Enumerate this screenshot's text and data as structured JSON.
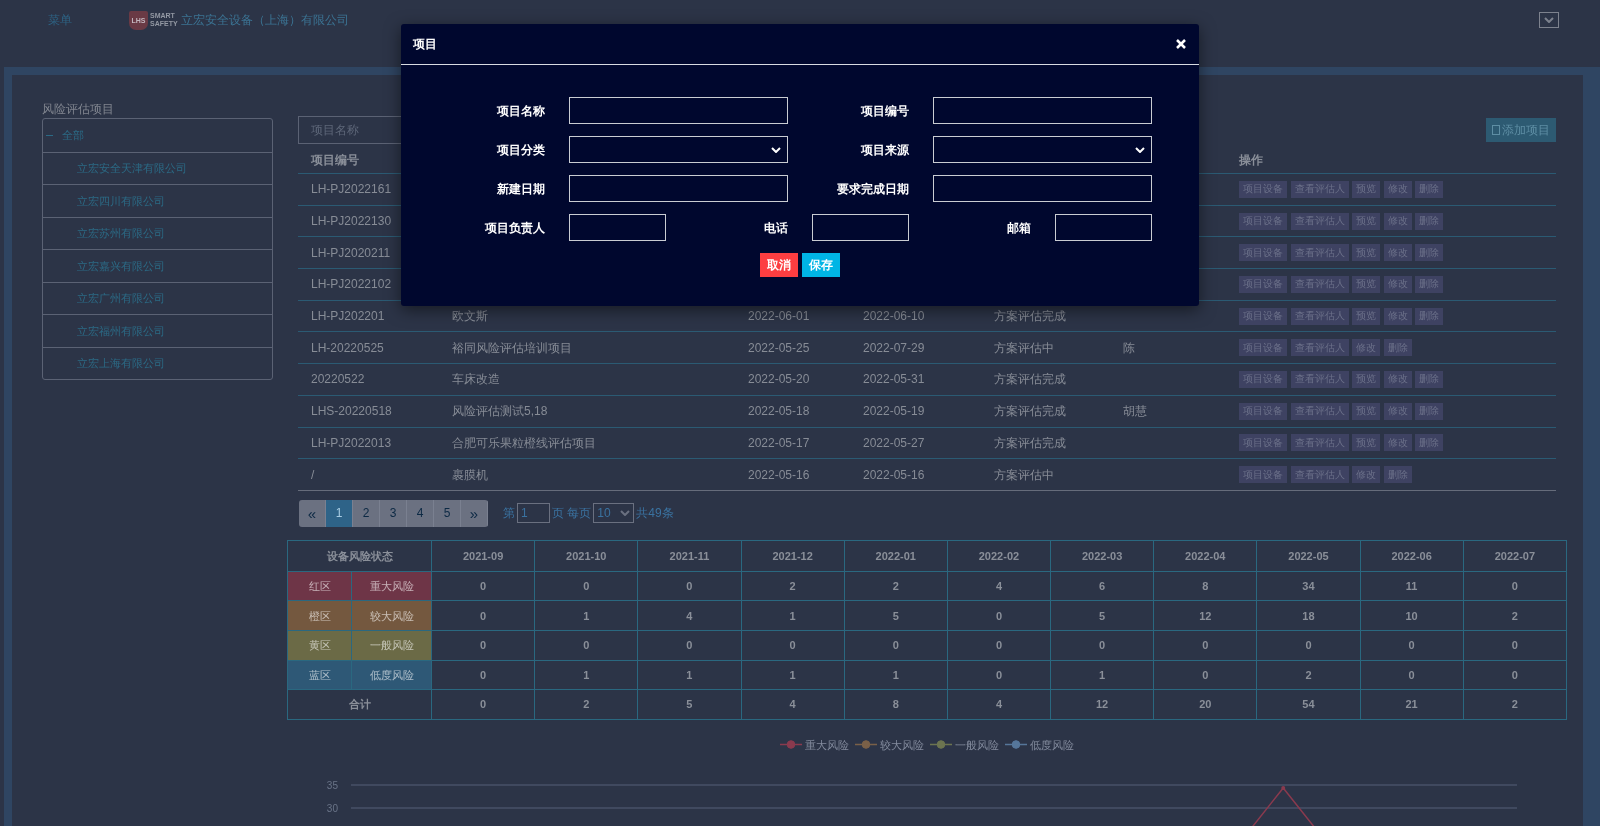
{
  "header": {
    "menu": "菜单",
    "logo": {
      "mark": "LHS",
      "wordmark": [
        "SMART",
        "SAFETY"
      ]
    },
    "company": "立宏安全设备（上海）有限公司"
  },
  "sidebar": {
    "title": "风险评估项目",
    "tree": [
      {
        "label": "全部",
        "expanded": true,
        "children": [
          {
            "label": "立宏安全天津有限公司"
          },
          {
            "label": "立宏四川有限公司"
          },
          {
            "label": "立宏苏州有限公司"
          },
          {
            "label": "立宏嘉兴有限公司"
          },
          {
            "label": "立宏广州有限公司"
          },
          {
            "label": "立宏福州有限公司"
          },
          {
            "label": "立宏上海有限公司"
          }
        ]
      }
    ]
  },
  "toolbar": {
    "search": {
      "placeholder": "项目名称"
    },
    "add_button": "添加项目"
  },
  "projects_table": {
    "headers": {
      "code": "项目编号",
      "actions": "操作"
    },
    "rows": [
      {
        "code": "LH-PJ2022161",
        "actions": [
          "项目设备",
          "查看评估人",
          "预览",
          "修改",
          "删除"
        ]
      },
      {
        "code": "LH-PJ2022130",
        "actions": [
          "项目设备",
          "查看评估人",
          "预览",
          "修改",
          "删除"
        ]
      },
      {
        "code": "LH-PJ2020211",
        "actions": [
          "项目设备",
          "查看评估人",
          "预览",
          "修改",
          "删除"
        ]
      },
      {
        "code": "LH-PJ2022102",
        "actions": [
          "项目设备",
          "查看评估人",
          "预览",
          "修改",
          "删除"
        ]
      },
      {
        "code": "LH-PJ202201",
        "column_2": "欧文斯",
        "column_3": "2022-06-01",
        "column_4": "2022-06-10",
        "column_5": "方案评估完成",
        "actions": [
          "项目设备",
          "查看评估人",
          "预览",
          "修改",
          "删除"
        ]
      },
      {
        "code": "LH-20220525",
        "column_2": "裕同风险评估培训项目",
        "column_3": "2022-05-25",
        "column_4": "2022-07-29",
        "column_5": "方案评估中",
        "column_6": "陈",
        "actions": [
          "项目设备",
          "查看评估人",
          "修改",
          "删除"
        ]
      },
      {
        "code": "20220522",
        "column_2": "车床改造",
        "column_3": "2022-05-20",
        "column_4": "2022-05-31",
        "column_5": "方案评估完成",
        "actions": [
          "项目设备",
          "查看评估人",
          "预览",
          "修改",
          "删除"
        ]
      },
      {
        "code": "LHS-20220518",
        "column_2": "风险评估测试5,18",
        "column_3": "2022-05-18",
        "column_4": "2022-05-19",
        "column_5": "方案评估完成",
        "column_6": "胡慧",
        "actions": [
          "项目设备",
          "查看评估人",
          "预览",
          "修改",
          "删除"
        ]
      },
      {
        "code": "LH-PJ2022013",
        "column_2": "合肥可乐果粒橙线评估项目",
        "column_3": "2022-05-17",
        "column_4": "2022-05-27",
        "column_5": "方案评估完成",
        "actions": [
          "项目设备",
          "查看评估人",
          "预览",
          "修改",
          "删除"
        ]
      },
      {
        "code": "/",
        "column_2": "裹膜机",
        "column_3": "2022-05-16",
        "column_4": "2022-05-16",
        "column_5": "方案评估中",
        "actions": [
          "项目设备",
          "查看评估人",
          "修改",
          "删除"
        ]
      }
    ]
  },
  "pagination": {
    "pages": [
      {
        "label": "«",
        "kind": "prev",
        "selected": false
      },
      {
        "label": "1",
        "kind": "page",
        "selected": true
      },
      {
        "label": "2",
        "kind": "page",
        "selected": false
      },
      {
        "label": "3",
        "kind": "page",
        "selected": false
      },
      {
        "label": "4",
        "kind": "page",
        "selected": false
      },
      {
        "label": "5",
        "kind": "page",
        "selected": false
      },
      {
        "label": "»",
        "kind": "next",
        "selected": false
      }
    ],
    "jump": {
      "prefix": "第",
      "value": "1",
      "suffix": "页 每页"
    },
    "page_size": {
      "value": "10"
    },
    "total": "共49条"
  },
  "risk_stats": {
    "header": "设备风险状态",
    "months": [
      "2021-09",
      "2021-10",
      "2021-11",
      "2021-12",
      "2022-01",
      "2022-02",
      "2022-03",
      "2022-04",
      "2022-05",
      "2022-06",
      "2022-07"
    ],
    "rows": [
      {
        "zone": "红区",
        "risk": "重大风险",
        "color": "#6e3547",
        "values": [
          "0",
          "0",
          "0",
          "2",
          "2",
          "4",
          "6",
          "8",
          "34",
          "11",
          "0"
        ]
      },
      {
        "zone": "橙区",
        "risk": "较大风险",
        "color": "#74583f",
        "values": [
          "0",
          "1",
          "4",
          "1",
          "5",
          "0",
          "5",
          "12",
          "18",
          "10",
          "2"
        ]
      },
      {
        "zone": "黄区",
        "risk": "一般风险",
        "color": "#6b6a46",
        "values": [
          "0",
          "0",
          "0",
          "0",
          "0",
          "0",
          "0",
          "0",
          "0",
          "0",
          "0"
        ]
      },
      {
        "zone": "蓝区",
        "risk": "低度风险",
        "color": "#2e5876",
        "values": [
          "0",
          "1",
          "1",
          "1",
          "1",
          "0",
          "1",
          "0",
          "2",
          "0",
          "0"
        ]
      }
    ],
    "total": {
      "label": "合计",
      "values": [
        "0",
        "2",
        "5",
        "4",
        "8",
        "4",
        "12",
        "20",
        "54",
        "21",
        "2"
      ]
    }
  },
  "chart": {
    "legend": [
      {
        "label": "重大风险",
        "color": "#8a3a4e"
      },
      {
        "label": "较大风险",
        "color": "#7a6048"
      },
      {
        "label": "一般风险",
        "color": "#6c7450"
      },
      {
        "label": "低度风险",
        "color": "#56769a"
      }
    ],
    "y_tick_labels": [
      "35",
      "30"
    ]
  },
  "dialog": {
    "title": "项目",
    "fields": [
      {
        "label": "项目名称",
        "kind": "text"
      },
      {
        "label": "项目编号",
        "kind": "text"
      },
      {
        "label": "项目分类",
        "kind": "select"
      },
      {
        "label": "项目来源",
        "kind": "select"
      },
      {
        "label": "新建日期",
        "kind": "text"
      },
      {
        "label": "要求完成日期",
        "kind": "text"
      }
    ],
    "contact_fields": [
      {
        "label": "项目负责人"
      },
      {
        "label": "电话"
      },
      {
        "label": "邮箱"
      }
    ],
    "buttons": [
      {
        "label": "取消",
        "kind": "cancel"
      },
      {
        "label": "保存",
        "kind": "save"
      }
    ]
  }
}
